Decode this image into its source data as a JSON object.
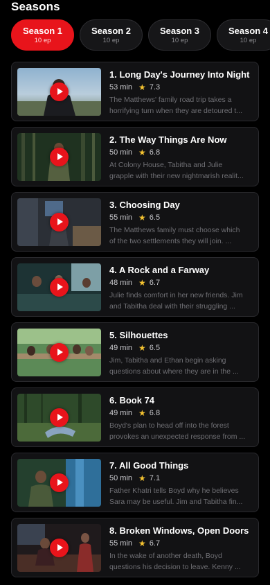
{
  "seasons_heading": "Seasons",
  "colors": {
    "accent": "#e8141b",
    "background": "#000000",
    "card": "#121214",
    "star": "#f6c431"
  },
  "tabs": [
    {
      "title": "Season 1",
      "sub": "10 ep",
      "active": true
    },
    {
      "title": "Season 2",
      "sub": "10 ep",
      "active": false
    },
    {
      "title": "Season 3",
      "sub": "10 ep",
      "active": false
    },
    {
      "title": "Season 4",
      "sub": "10 ep",
      "active": false
    }
  ],
  "episodes": [
    {
      "title": "1. Long Day's Journey Into Night",
      "duration": "53 min",
      "rating": "7.3",
      "desc_line1": "The Matthews' family road trip takes a",
      "desc_line2": "horrifying turn when they are detoured t..."
    },
    {
      "title": "2. The Way Things Are Now",
      "duration": "50 min",
      "rating": "6.8",
      "desc_line1": "At Colony House, Tabitha and Julie",
      "desc_line2": "grapple with their new nightmarish realit..."
    },
    {
      "title": "3. Choosing Day",
      "duration": "55 min",
      "rating": "6.5",
      "desc_line1": "The Matthews family must choose which",
      "desc_line2": "of the two settlements they will join. ..."
    },
    {
      "title": "4. A Rock and a Farway",
      "duration": "48 min",
      "rating": "6.7",
      "desc_line1": "Julie finds comfort in her new friends. Jim",
      "desc_line2": "and Tabitha deal with their struggling ..."
    },
    {
      "title": "5. Silhouettes",
      "duration": "49 min",
      "rating": "6.5",
      "desc_line1": "Jim, Tabitha and Ethan begin asking",
      "desc_line2": "questions about where they are in the ..."
    },
    {
      "title": "6. Book 74",
      "duration": "49 min",
      "rating": "6.8",
      "desc_line1": "Boyd's plan to head off into the forest",
      "desc_line2": "provokes an unexpected response from ..."
    },
    {
      "title": "7. All Good Things",
      "duration": "50 min",
      "rating": "7.1",
      "desc_line1": "Father Khatri tells Boyd why he believes",
      "desc_line2": "Sara may be useful. Jim and Tabitha fin..."
    },
    {
      "title": "8. Broken Windows, Open Doors",
      "duration": "55 min",
      "rating": "6.7",
      "desc_line1": "In the wake of another death, Boyd",
      "desc_line2": "questions his decision to leave. Kenny ..."
    }
  ]
}
